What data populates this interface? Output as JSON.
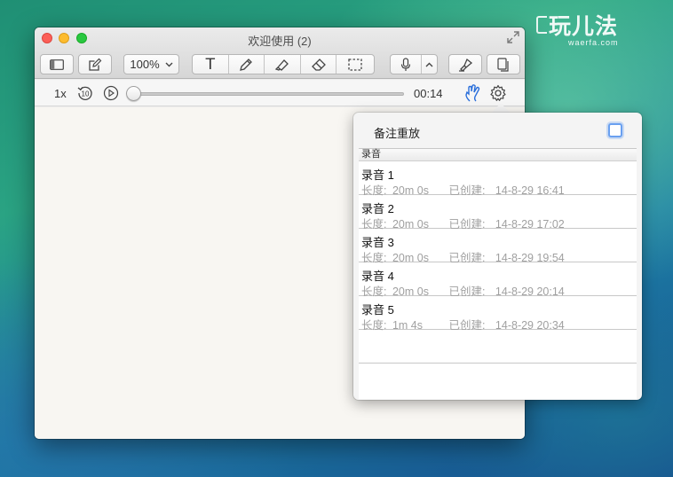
{
  "watermark": {
    "main": "玩儿法",
    "sub": "waerfa.com"
  },
  "window": {
    "title": "欢迎使用 (2)",
    "toolbar": {
      "zoom": "100%",
      "text_tool": "T"
    },
    "player": {
      "speed": "1x",
      "elapsed": "00:14",
      "progress": 0.0
    }
  },
  "popover": {
    "replay_notes_label": "备注重放",
    "replay_notes_checked": false,
    "list_header": "录音",
    "recordings": [
      {
        "name": "录音 1",
        "length_label": "长度:",
        "length": "20m 0s",
        "created_label": "已创建:",
        "created": "14-8-29 16:41"
      },
      {
        "name": "录音 2",
        "length_label": "长度:",
        "length": "20m 0s",
        "created_label": "已创建:",
        "created": "14-8-29 17:02"
      },
      {
        "name": "录音 3",
        "length_label": "长度:",
        "length": "20m 0s",
        "created_label": "已创建:",
        "created": "14-8-29 19:54"
      },
      {
        "name": "录音 4",
        "length_label": "长度:",
        "length": "20m 0s",
        "created_label": "已创建:",
        "created": "14-8-29 20:14"
      },
      {
        "name": "录音 5",
        "length_label": "长度:",
        "length": "1m 4s",
        "created_label": "已创建:",
        "created": "14-8-29 20:34"
      }
    ]
  },
  "colors": {
    "accent": "#2a6fdb",
    "close": "#fc5f57",
    "minimize": "#fdbc2e",
    "maximize": "#29c840"
  }
}
